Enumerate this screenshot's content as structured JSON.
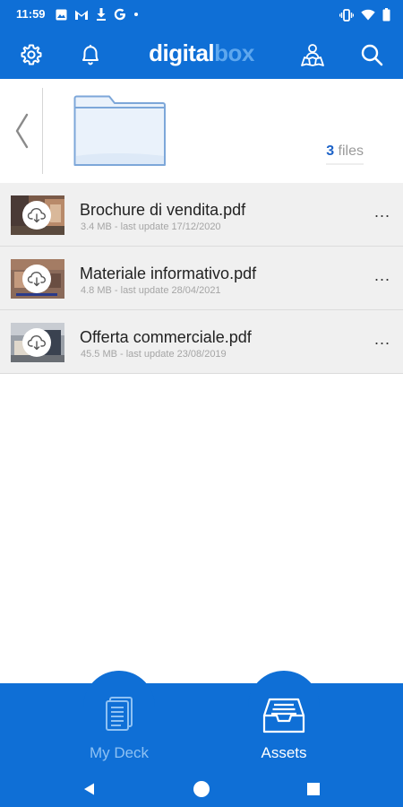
{
  "status_bar": {
    "time": "11:59",
    "left_icons": [
      "image-icon",
      "gmail-icon",
      "download-icon",
      "google-icon",
      "dot-icon"
    ],
    "right_icons": [
      "vibrate-icon",
      "wifi-icon",
      "battery-icon"
    ]
  },
  "app_bar": {
    "logo_part1": "digital",
    "logo_part2": "box",
    "buttons": [
      "gear-icon",
      "bell-icon",
      "map-user-icon",
      "search-icon"
    ]
  },
  "folder": {
    "count": "3",
    "count_label": "files"
  },
  "files": [
    {
      "name": "Brochure di vendita.pdf",
      "meta": "3.4 MB - last update 17/12/2020",
      "more": "..."
    },
    {
      "name": "Materiale informativo.pdf",
      "meta": "4.8 MB - last update 28/04/2021",
      "more": "..."
    },
    {
      "name": "Offerta commerciale.pdf",
      "meta": "45.5 MB - last update 23/08/2019",
      "more": "..."
    }
  ],
  "bottom_nav": {
    "items": [
      {
        "label": "My Deck",
        "icon": "document-stack-icon",
        "active": false
      },
      {
        "label": "Assets",
        "icon": "inbox-tray-icon",
        "active": true
      }
    ]
  },
  "colors": {
    "primary": "#0f6fd6",
    "accent_light": "#5ea7ee",
    "count_blue": "#1d63c8",
    "row_bg": "#f0f0f0"
  }
}
